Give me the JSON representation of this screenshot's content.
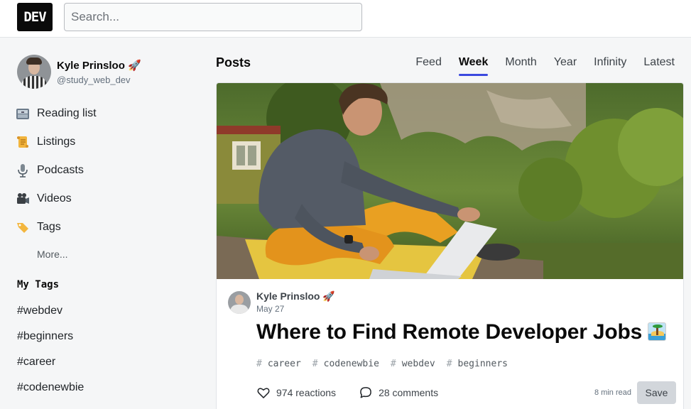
{
  "header": {
    "logo_text": "DEV",
    "search_placeholder": "Search..."
  },
  "sidebar": {
    "user": {
      "name": "Kyle Prinsloo 🚀",
      "handle": "@study_web_dev"
    },
    "items": [
      {
        "label": "Reading list",
        "icon": "reading-list-icon"
      },
      {
        "label": "Listings",
        "icon": "scroll-icon"
      },
      {
        "label": "Podcasts",
        "icon": "microphone-icon"
      },
      {
        "label": "Videos",
        "icon": "video-camera-icon"
      },
      {
        "label": "Tags",
        "icon": "tag-icon"
      }
    ],
    "more_label": "More...",
    "my_tags_title": "My Tags",
    "tags": [
      "#webdev",
      "#beginners",
      "#career",
      "#codenewbie"
    ]
  },
  "main": {
    "title": "Posts",
    "tabs": [
      "Feed",
      "Week",
      "Month",
      "Year",
      "Infinity",
      "Latest"
    ],
    "active_tab": "Week",
    "post": {
      "author": "Kyle Prinsloo 🚀",
      "date": "May 27",
      "title": "Where to Find Remote Developer Jobs",
      "title_emoji": "desert-island-icon",
      "tags": [
        "career",
        "codenewbie",
        "webdev",
        "beginners"
      ],
      "reactions_label": "974 reactions",
      "comments_label": "28 comments",
      "read_time": "8 min read",
      "save_label": "Save"
    }
  },
  "colors": {
    "accent": "#3b49df",
    "save_button_bg": "#d2d6db",
    "page_bg": "#f5f6f7"
  }
}
